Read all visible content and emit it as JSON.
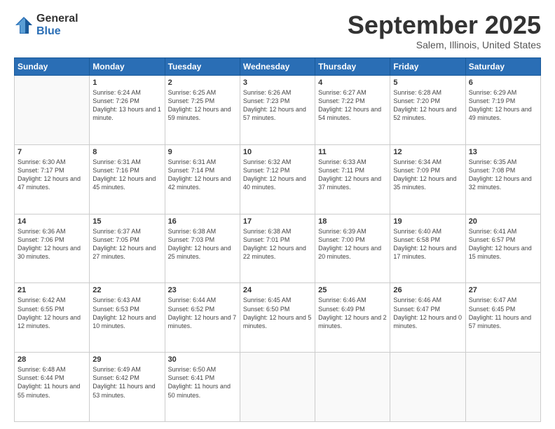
{
  "logo": {
    "general": "General",
    "blue": "Blue"
  },
  "title": "September 2025",
  "location": "Salem, Illinois, United States",
  "headers": [
    "Sunday",
    "Monday",
    "Tuesday",
    "Wednesday",
    "Thursday",
    "Friday",
    "Saturday"
  ],
  "weeks": [
    [
      {
        "day": "",
        "info": ""
      },
      {
        "day": "1",
        "info": "Sunrise: 6:24 AM\nSunset: 7:26 PM\nDaylight: 13 hours\nand 1 minute."
      },
      {
        "day": "2",
        "info": "Sunrise: 6:25 AM\nSunset: 7:25 PM\nDaylight: 12 hours\nand 59 minutes."
      },
      {
        "day": "3",
        "info": "Sunrise: 6:26 AM\nSunset: 7:23 PM\nDaylight: 12 hours\nand 57 minutes."
      },
      {
        "day": "4",
        "info": "Sunrise: 6:27 AM\nSunset: 7:22 PM\nDaylight: 12 hours\nand 54 minutes."
      },
      {
        "day": "5",
        "info": "Sunrise: 6:28 AM\nSunset: 7:20 PM\nDaylight: 12 hours\nand 52 minutes."
      },
      {
        "day": "6",
        "info": "Sunrise: 6:29 AM\nSunset: 7:19 PM\nDaylight: 12 hours\nand 49 minutes."
      }
    ],
    [
      {
        "day": "7",
        "info": "Sunrise: 6:30 AM\nSunset: 7:17 PM\nDaylight: 12 hours\nand 47 minutes."
      },
      {
        "day": "8",
        "info": "Sunrise: 6:31 AM\nSunset: 7:16 PM\nDaylight: 12 hours\nand 45 minutes."
      },
      {
        "day": "9",
        "info": "Sunrise: 6:31 AM\nSunset: 7:14 PM\nDaylight: 12 hours\nand 42 minutes."
      },
      {
        "day": "10",
        "info": "Sunrise: 6:32 AM\nSunset: 7:12 PM\nDaylight: 12 hours\nand 40 minutes."
      },
      {
        "day": "11",
        "info": "Sunrise: 6:33 AM\nSunset: 7:11 PM\nDaylight: 12 hours\nand 37 minutes."
      },
      {
        "day": "12",
        "info": "Sunrise: 6:34 AM\nSunset: 7:09 PM\nDaylight: 12 hours\nand 35 minutes."
      },
      {
        "day": "13",
        "info": "Sunrise: 6:35 AM\nSunset: 7:08 PM\nDaylight: 12 hours\nand 32 minutes."
      }
    ],
    [
      {
        "day": "14",
        "info": "Sunrise: 6:36 AM\nSunset: 7:06 PM\nDaylight: 12 hours\nand 30 minutes."
      },
      {
        "day": "15",
        "info": "Sunrise: 6:37 AM\nSunset: 7:05 PM\nDaylight: 12 hours\nand 27 minutes."
      },
      {
        "day": "16",
        "info": "Sunrise: 6:38 AM\nSunset: 7:03 PM\nDaylight: 12 hours\nand 25 minutes."
      },
      {
        "day": "17",
        "info": "Sunrise: 6:38 AM\nSunset: 7:01 PM\nDaylight: 12 hours\nand 22 minutes."
      },
      {
        "day": "18",
        "info": "Sunrise: 6:39 AM\nSunset: 7:00 PM\nDaylight: 12 hours\nand 20 minutes."
      },
      {
        "day": "19",
        "info": "Sunrise: 6:40 AM\nSunset: 6:58 PM\nDaylight: 12 hours\nand 17 minutes."
      },
      {
        "day": "20",
        "info": "Sunrise: 6:41 AM\nSunset: 6:57 PM\nDaylight: 12 hours\nand 15 minutes."
      }
    ],
    [
      {
        "day": "21",
        "info": "Sunrise: 6:42 AM\nSunset: 6:55 PM\nDaylight: 12 hours\nand 12 minutes."
      },
      {
        "day": "22",
        "info": "Sunrise: 6:43 AM\nSunset: 6:53 PM\nDaylight: 12 hours\nand 10 minutes."
      },
      {
        "day": "23",
        "info": "Sunrise: 6:44 AM\nSunset: 6:52 PM\nDaylight: 12 hours\nand 7 minutes."
      },
      {
        "day": "24",
        "info": "Sunrise: 6:45 AM\nSunset: 6:50 PM\nDaylight: 12 hours\nand 5 minutes."
      },
      {
        "day": "25",
        "info": "Sunrise: 6:46 AM\nSunset: 6:49 PM\nDaylight: 12 hours\nand 2 minutes."
      },
      {
        "day": "26",
        "info": "Sunrise: 6:46 AM\nSunset: 6:47 PM\nDaylight: 12 hours\nand 0 minutes."
      },
      {
        "day": "27",
        "info": "Sunrise: 6:47 AM\nSunset: 6:45 PM\nDaylight: 11 hours\nand 57 minutes."
      }
    ],
    [
      {
        "day": "28",
        "info": "Sunrise: 6:48 AM\nSunset: 6:44 PM\nDaylight: 11 hours\nand 55 minutes."
      },
      {
        "day": "29",
        "info": "Sunrise: 6:49 AM\nSunset: 6:42 PM\nDaylight: 11 hours\nand 53 minutes."
      },
      {
        "day": "30",
        "info": "Sunrise: 6:50 AM\nSunset: 6:41 PM\nDaylight: 11 hours\nand 50 minutes."
      },
      {
        "day": "",
        "info": ""
      },
      {
        "day": "",
        "info": ""
      },
      {
        "day": "",
        "info": ""
      },
      {
        "day": "",
        "info": ""
      }
    ]
  ]
}
